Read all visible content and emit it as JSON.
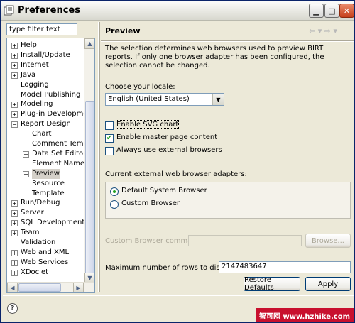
{
  "window": {
    "title": "Preferences"
  },
  "filter": {
    "placeholder": "type filter text"
  },
  "tree": [
    {
      "label": "Help",
      "indent": 0,
      "expander": "+"
    },
    {
      "label": "Install/Update",
      "indent": 0,
      "expander": "+"
    },
    {
      "label": "Internet",
      "indent": 0,
      "expander": "+"
    },
    {
      "label": "Java",
      "indent": 0,
      "expander": "+"
    },
    {
      "label": "Logging",
      "indent": 0,
      "expander": ""
    },
    {
      "label": "Model Publishing",
      "indent": 0,
      "expander": ""
    },
    {
      "label": "Modeling",
      "indent": 0,
      "expander": "+"
    },
    {
      "label": "Plug-in Development",
      "indent": 0,
      "expander": "+"
    },
    {
      "label": "Report Design",
      "indent": 0,
      "expander": "-"
    },
    {
      "label": "Chart",
      "indent": 1,
      "expander": ""
    },
    {
      "label": "Comment Templa",
      "indent": 1,
      "expander": ""
    },
    {
      "label": "Data Set Editor",
      "indent": 1,
      "expander": "+"
    },
    {
      "label": "Element Names",
      "indent": 1,
      "expander": ""
    },
    {
      "label": "Preview",
      "indent": 1,
      "expander": "+",
      "selected": true
    },
    {
      "label": "Resource",
      "indent": 1,
      "expander": ""
    },
    {
      "label": "Template",
      "indent": 1,
      "expander": ""
    },
    {
      "label": "Run/Debug",
      "indent": 0,
      "expander": "+"
    },
    {
      "label": "Server",
      "indent": 0,
      "expander": "+"
    },
    {
      "label": "SQL Development",
      "indent": 0,
      "expander": "+"
    },
    {
      "label": "Team",
      "indent": 0,
      "expander": "+"
    },
    {
      "label": "Validation",
      "indent": 0,
      "expander": ""
    },
    {
      "label": "Web and XML",
      "indent": 0,
      "expander": "+"
    },
    {
      "label": "Web Services",
      "indent": 0,
      "expander": "+"
    },
    {
      "label": "XDoclet",
      "indent": 0,
      "expander": "+"
    }
  ],
  "page": {
    "title": "Preview",
    "description": "The selection determines web browsers used to preview BIRT reports. If only one browser adapter has been configured, the selection cannot be changed.",
    "locale_label": "Choose your locale:",
    "locale_value": "English (United States)",
    "cb_svg": "Enable SVG chart",
    "cb_master": "Enable master page content",
    "cb_external": "Always use external browsers",
    "adapters_label": "Current external web browser adapters:",
    "radio_default": "Default System Browser",
    "radio_custom": "Custom Browser",
    "cmd_label": "Custom Browser command:",
    "browse": "Browse...",
    "rows_label": "Maximum number of rows to display:",
    "rows_value": "2147483647",
    "restore": "Restore Defaults",
    "apply": "Apply"
  },
  "watermark": "智可网  www.hzhike.com",
  "checks": {
    "svg": false,
    "master": true,
    "external": false
  },
  "radios": {
    "default": true,
    "custom": false
  }
}
